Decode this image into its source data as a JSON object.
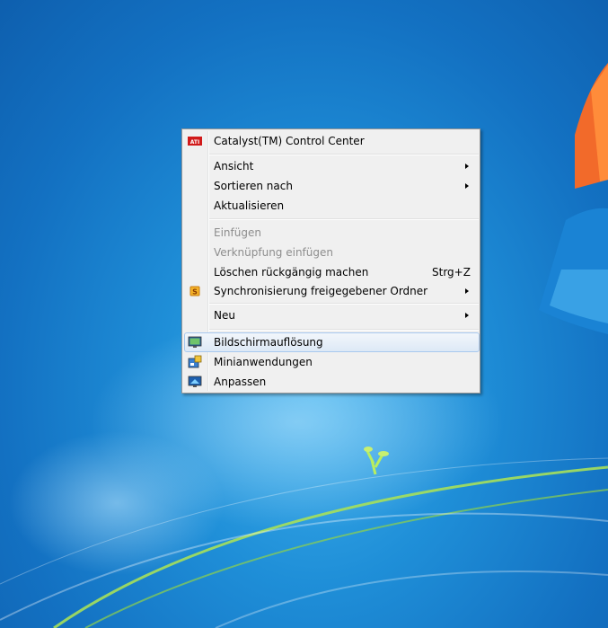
{
  "context_menu": {
    "items": [
      {
        "label": "Catalyst(TM) Control Center",
        "icon": "ati-icon",
        "submenu": false
      },
      {
        "label": "Ansicht",
        "submenu": true
      },
      {
        "label": "Sortieren nach",
        "submenu": true
      },
      {
        "label": "Aktualisieren",
        "submenu": false
      },
      {
        "label": "Einfügen",
        "disabled": true
      },
      {
        "label": "Verknüpfung einfügen",
        "disabled": true
      },
      {
        "label": "Löschen rückgängig machen",
        "shortcut": "Strg+Z"
      },
      {
        "label": "Synchronisierung freigegebener Ordner",
        "icon": "sync-icon",
        "submenu": true
      },
      {
        "label": "Neu",
        "submenu": true
      },
      {
        "label": "Bildschirmauflösung",
        "icon": "display-resolution-icon",
        "hovered": true
      },
      {
        "label": "Minianwendungen",
        "icon": "gadgets-icon"
      },
      {
        "label": "Anpassen",
        "icon": "personalize-icon"
      }
    ]
  },
  "colors": {
    "desktop_blue": "#1f8fd8",
    "menu_bg": "#f0f0f0",
    "hover_border": "#a8c8ee",
    "disabled_text": "#8d8d8d"
  }
}
